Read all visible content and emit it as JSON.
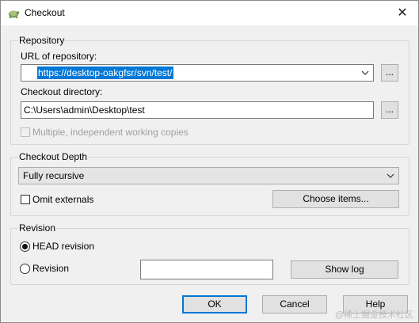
{
  "window": {
    "title": "Checkout",
    "close_glyph": "✕"
  },
  "repository": {
    "group_label": "Repository",
    "url_label": "URL of repository:",
    "url_value": "https://desktop-oakgfsr/svn/test/",
    "browse_label": "...",
    "dir_label": "Checkout directory:",
    "dir_value": "C:\\Users\\admin\\Desktop\\test",
    "dir_browse_label": "...",
    "multiple_label": "Multiple, independent working copies",
    "multiple_checked": false
  },
  "depth": {
    "group_label": "Checkout Depth",
    "selected": "Fully recursive",
    "omit_label": "Omit externals",
    "omit_checked": false,
    "choose_items_label": "Choose items..."
  },
  "revision": {
    "group_label": "Revision",
    "head_label": "HEAD revision",
    "revision_label": "Revision",
    "revision_value": "",
    "selected": "HEAD revision",
    "show_log_label": "Show log"
  },
  "buttons": {
    "ok": "OK",
    "cancel": "Cancel",
    "help": "Help"
  },
  "watermark": "@稀土掘金技术社区",
  "colors": {
    "accent": "#0078d7",
    "dialog_bg": "#f0f0f0"
  }
}
